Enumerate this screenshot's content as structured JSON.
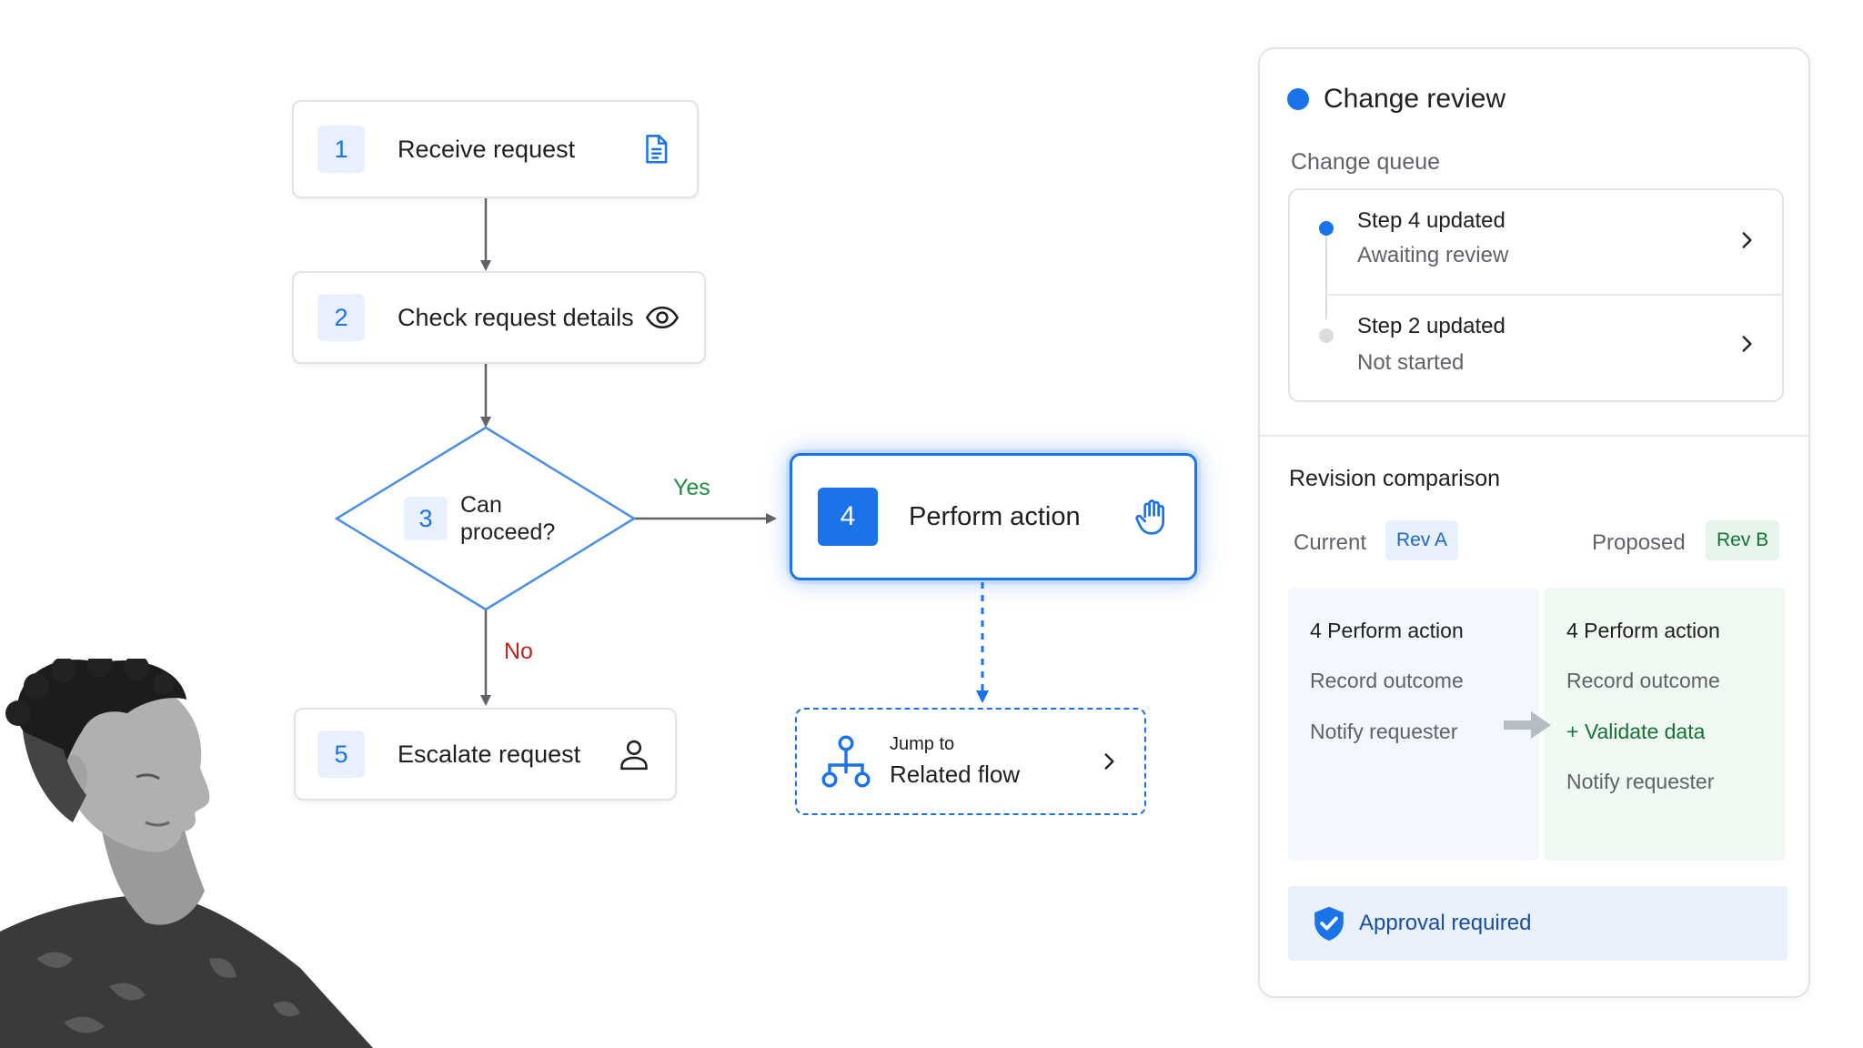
{
  "flow": {
    "step1": {
      "number": "1",
      "label": "Receive request",
      "icon": "document-icon"
    },
    "step2": {
      "number": "2",
      "label": "Check request details",
      "icon": "eye-icon"
    },
    "step3": {
      "number": "3",
      "label": "Can proceed?",
      "shape": "diamond"
    },
    "step4": {
      "number": "4",
      "label": "Perform action",
      "icon": "hand-icon",
      "state": "selected"
    },
    "step5": {
      "number": "5",
      "label": "Escalate request",
      "icon": "person-icon"
    },
    "yes_label": "Yes",
    "no_label": "No",
    "jump": {
      "small": "Jump to",
      "main": "Related flow",
      "icon": "flow-tree-icon"
    }
  },
  "panel": {
    "title": "Change review",
    "queue_heading": "Change queue",
    "queue": [
      {
        "title": "Step 4 updated",
        "status": "Awaiting review",
        "dot_color": "#1a73e8"
      },
      {
        "title": "Step 2 updated",
        "status": "Not started",
        "dot_color": "#dadce0"
      }
    ],
    "revision": {
      "heading": "Revision comparison",
      "current_label": "Current",
      "current_chip": "Rev A",
      "proposed_label": "Proposed",
      "proposed_chip": "Rev B",
      "current_lines": [
        "4  Perform action",
        "Record outcome",
        "Notify requester"
      ],
      "proposed_lines": [
        "4  Perform action",
        "Record outcome",
        "+ Validate data",
        "Notify requester"
      ]
    },
    "approval": "Approval required"
  },
  "colors": {
    "accent": "#1a73e8",
    "yes": "#1e8e3e",
    "no": "#c5221f",
    "added": "#137333"
  }
}
